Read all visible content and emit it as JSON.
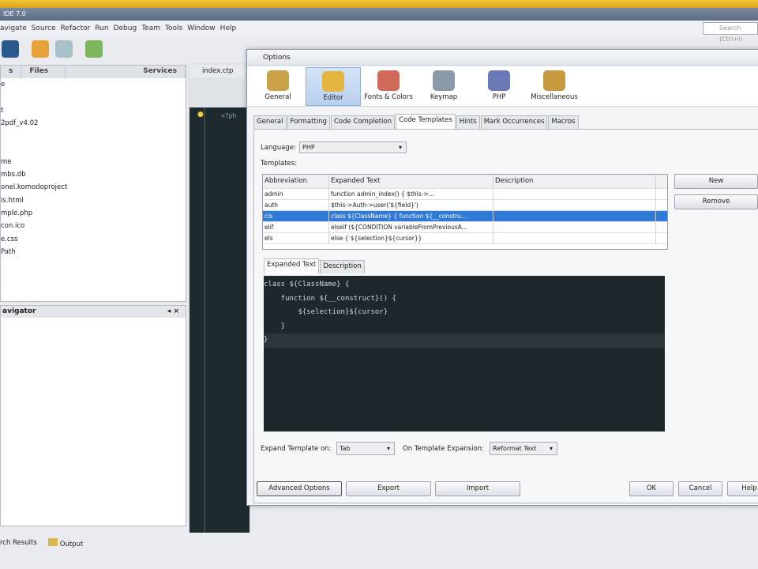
{
  "window": {
    "title": "IDE 7.0",
    "search_placeholder": "Search (Ctrl+I)"
  },
  "menu": [
    "avigate",
    "Source",
    "Refactor",
    "Run",
    "Debug",
    "Team",
    "Tools",
    "Window",
    "Help"
  ],
  "left_panel": {
    "tabs": [
      "s",
      "Files",
      "Services"
    ],
    "files": [
      "e",
      "",
      "t",
      "2pdf_v4.02",
      "",
      "",
      "me",
      "mbs.db",
      "onel.komodoproject",
      "is.html",
      "mple.php",
      "con.ico",
      "e.css",
      "Path"
    ]
  },
  "navigator": {
    "title": "avigator"
  },
  "editor": {
    "tab": "index.ctp",
    "code_start": "<?ph"
  },
  "bottom": {
    "search_results": "rch Results",
    "output": "Output"
  },
  "dialog": {
    "title": "Options",
    "categories": [
      {
        "label": "General",
        "icon": "general-icon"
      },
      {
        "label": "Editor",
        "icon": "editor-icon",
        "selected": true
      },
      {
        "label": "Fonts & Colors",
        "icon": "fonts-colors-icon"
      },
      {
        "label": "Keymap",
        "icon": "keymap-icon"
      },
      {
        "label": "PHP",
        "icon": "php-icon"
      },
      {
        "label": "Miscellaneous",
        "icon": "misc-icon"
      }
    ],
    "tabs": [
      "General",
      "Formatting",
      "Code Completion",
      "Code Templates",
      "Hints",
      "Mark Occurrences",
      "Macros"
    ],
    "selected_tab": "Code Templates",
    "language_label": "Language:",
    "language_value": "PHP",
    "templates_label": "Templates:",
    "columns": [
      "Abbreviation",
      "Expanded Text",
      "Description"
    ],
    "rows": [
      {
        "abbr": "admin",
        "text": "     function admin_index() {        $this->...",
        "desc": ""
      },
      {
        "abbr": "auth",
        "text": "$this->Auth->user('${field}')",
        "desc": ""
      },
      {
        "abbr": "cls",
        "text": "class ${ClassName} {    function ${__constru...",
        "desc": "",
        "selected": true
      },
      {
        "abbr": "elif",
        "text": "elseif (${CONDITION variableFromPreviousA...",
        "desc": ""
      },
      {
        "abbr": "els",
        "text": "else {    ${selection}${cursor}}",
        "desc": ""
      }
    ],
    "new_label": "New",
    "remove_label": "Remove",
    "subtabs": [
      "Expanded Text",
      "Description"
    ],
    "code_lines": [
      "class ${ClassName} {",
      "    function ${__construct}() {",
      "        ${selection}${cursor}",
      "    }",
      "}"
    ],
    "expand_on_label": "Expand Template on:",
    "expand_on_value": "Tab",
    "on_expansion_label": "On Template Expansion:",
    "on_expansion_value": "Reformat Text",
    "buttons": {
      "advanced": "Advanced Options",
      "export": "Export",
      "import": "Import",
      "ok": "OK",
      "cancel": "Cancel",
      "help": "Help"
    }
  }
}
